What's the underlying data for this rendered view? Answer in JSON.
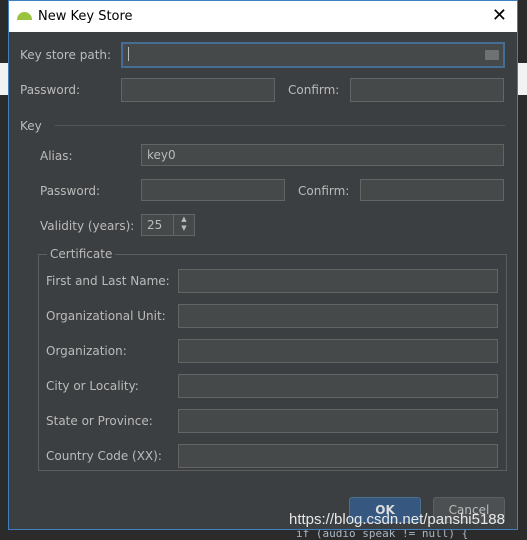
{
  "window": {
    "title": "New Key Store",
    "close": "✕"
  },
  "keystore": {
    "path_label": "Key store path:",
    "path_value": "",
    "password_label": "Password:",
    "confirm_label": "Confirm:"
  },
  "key": {
    "section": "Key",
    "alias_label": "Alias:",
    "alias_value": "key0",
    "password_label": "Password:",
    "confirm_label": "Confirm:",
    "validity_label": "Validity (years):",
    "validity_value": "25"
  },
  "certificate": {
    "legend": "Certificate",
    "fields": [
      "First and Last Name:",
      "Organizational Unit:",
      "Organization:",
      "City or Locality:",
      "State or Province:",
      "Country Code (XX):"
    ]
  },
  "buttons": {
    "ok": "OK",
    "cancel": "Cancel"
  },
  "background": {
    "code": "if (audio speak != null) {",
    "watermark": "https://blog.csdn.net/panshi5188"
  },
  "colors": {
    "dialog_bg": "#3c3f41",
    "accent": "#365880",
    "android": "#9bc33f"
  }
}
